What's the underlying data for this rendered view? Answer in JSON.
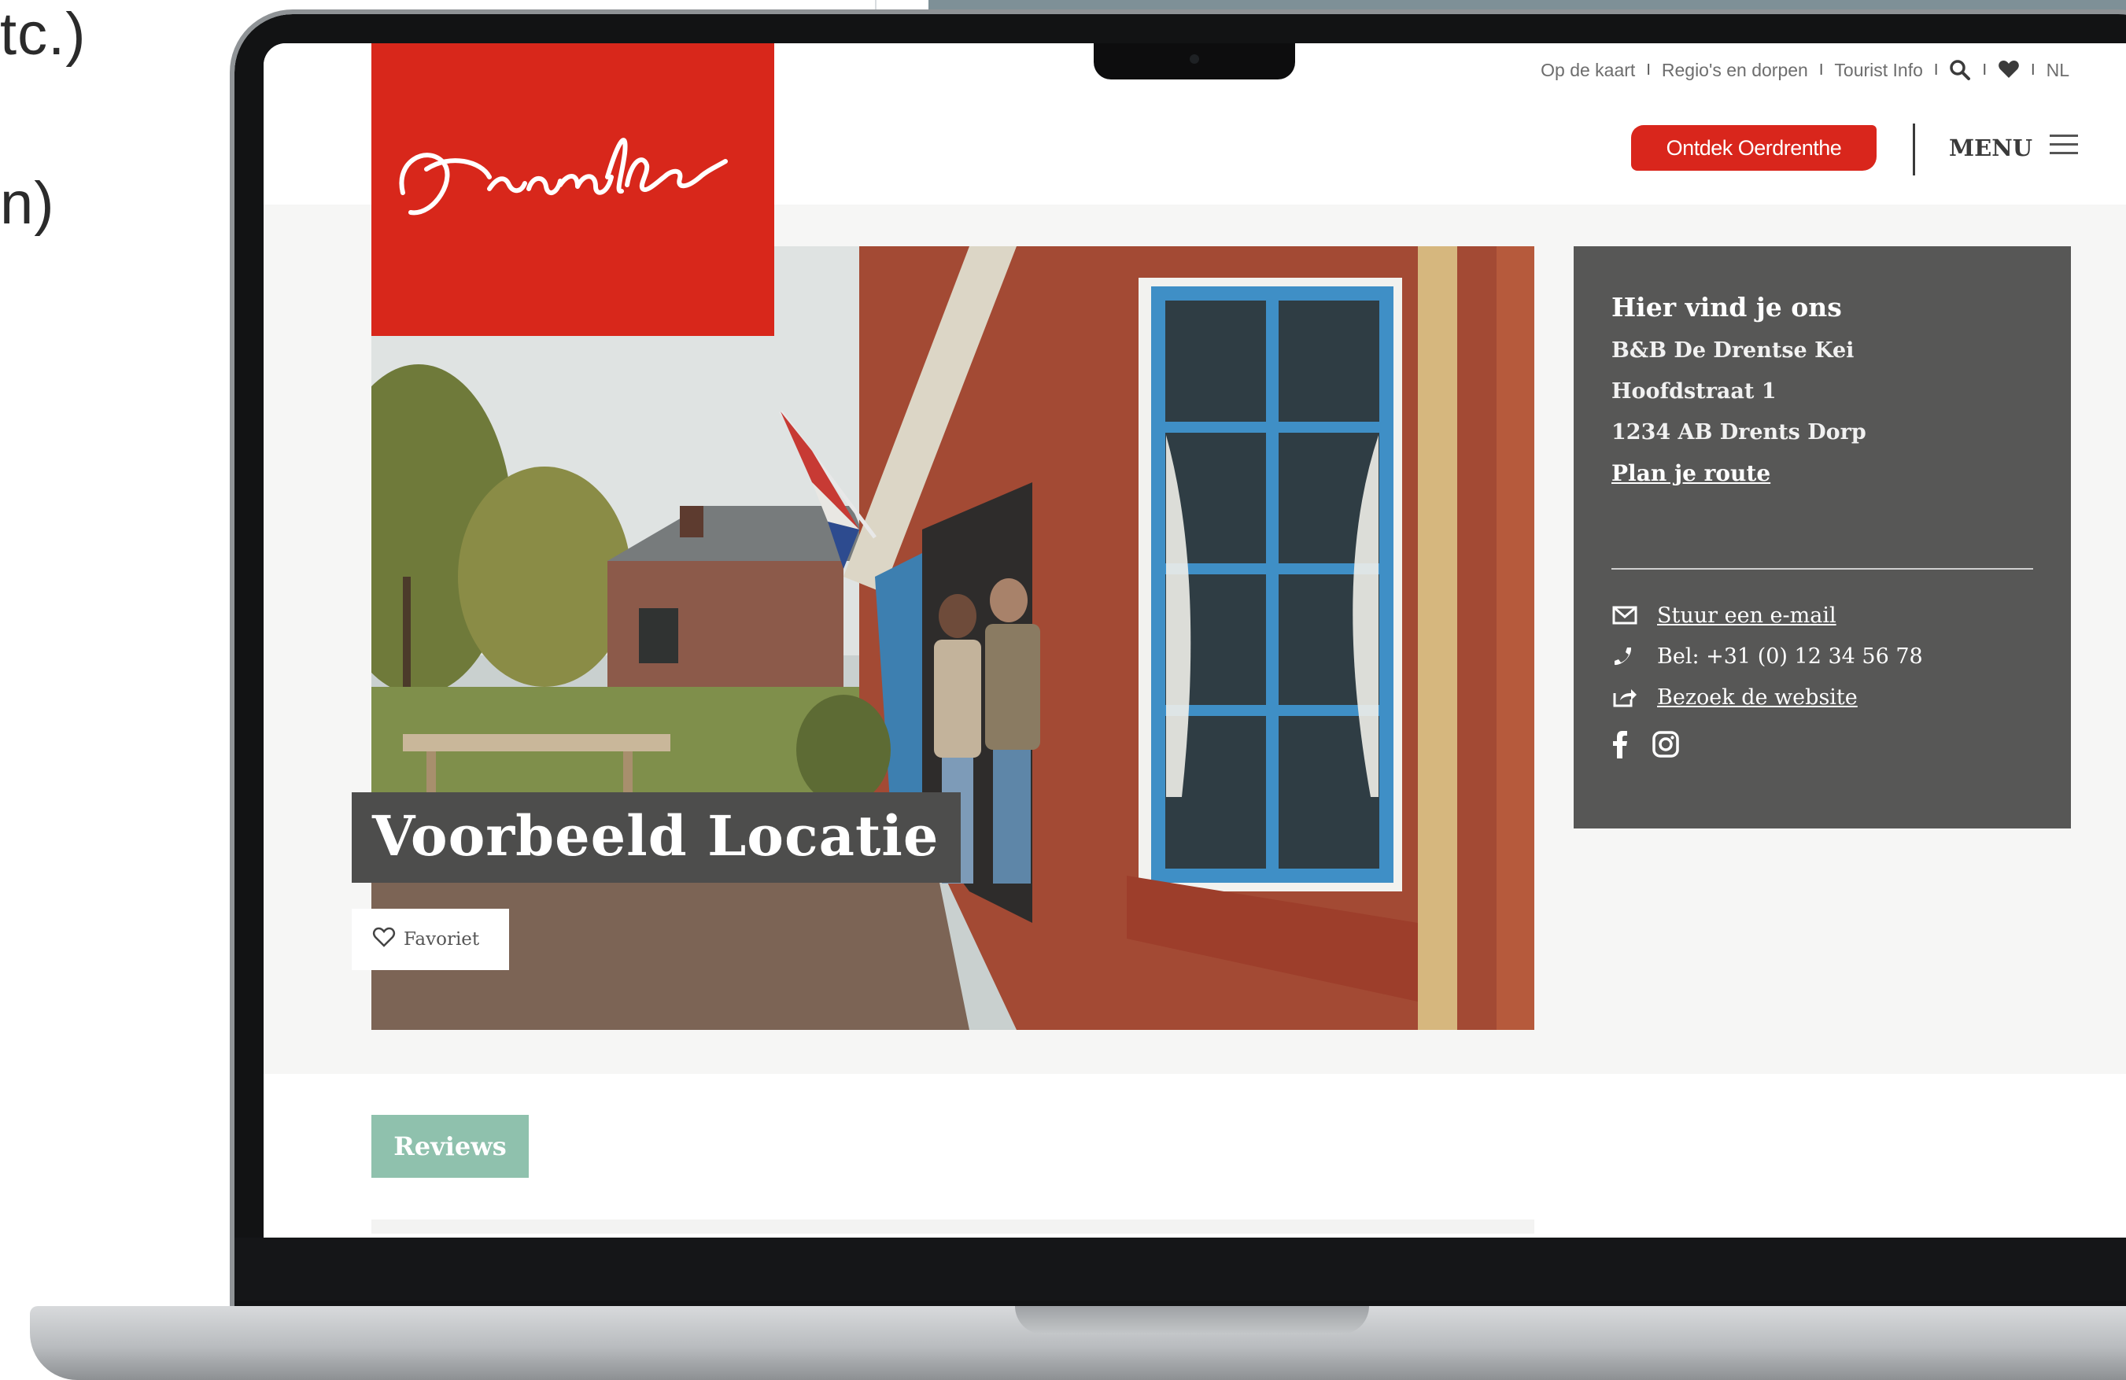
{
  "background": {
    "text_top": "tc.)",
    "text_mid": "n)"
  },
  "site": {
    "brand": "Drenthe",
    "brand_color": "#d8271b",
    "top_links": [
      "Op de kaart",
      "Regio's en dorpen",
      "Tourist Info"
    ],
    "top_separator": "I",
    "language": "NL",
    "cta_label": "Ontdek Oerdrenthe",
    "menu_label": "MENU"
  },
  "location": {
    "title": "Voorbeeld Locatie",
    "favorite_label": "Favoriet"
  },
  "info": {
    "heading": "Hier vind je ons",
    "name": "B&B De Drentse Kei",
    "street": "Hoofdstraat 1",
    "city": "1234 AB Drents Dorp",
    "route_label": "Plan je route",
    "email_label": "Stuur een e-mail",
    "phone_label": "Bel: +31 (0) 12 34 56 78",
    "website_label": "Bezoek de website",
    "panel_color": "#575756"
  },
  "reviews": {
    "label": "Reviews",
    "color": "#8fc1ad"
  },
  "icons": [
    "search-icon",
    "heart-icon",
    "menu-icon",
    "heart-outline-icon",
    "mail-icon",
    "phone-icon",
    "external-link-icon",
    "facebook-icon",
    "instagram-icon"
  ]
}
